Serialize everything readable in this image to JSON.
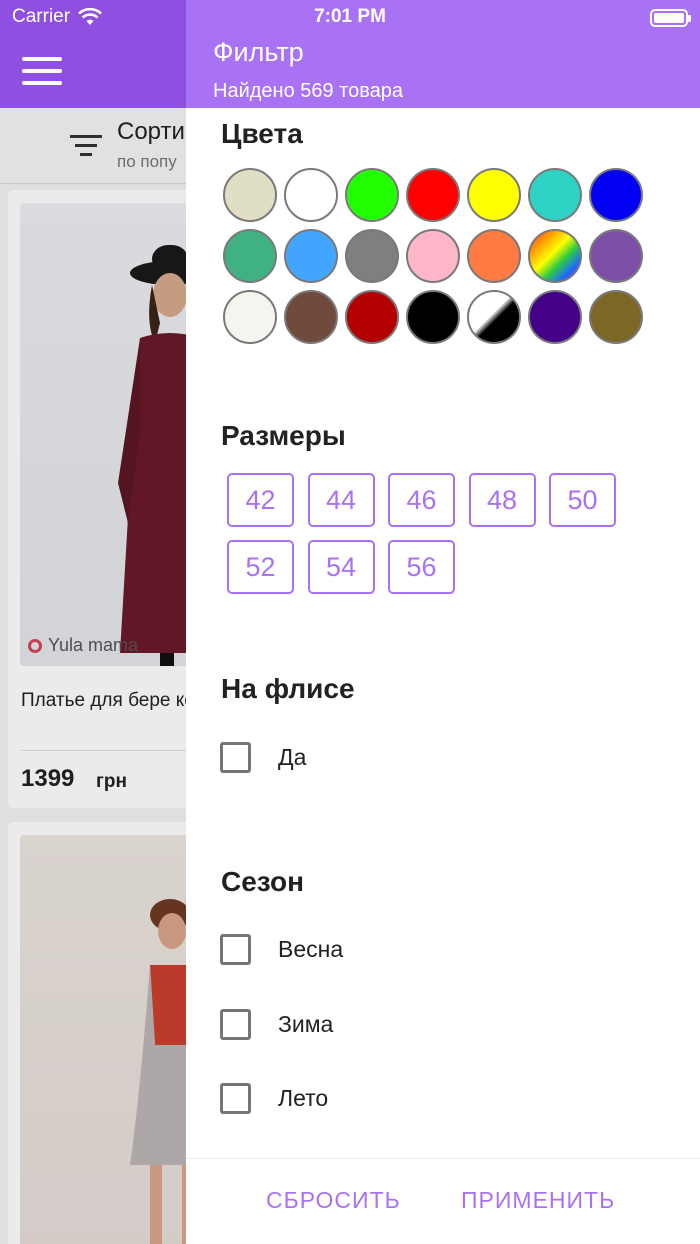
{
  "status_bar": {
    "carrier": "Carrier",
    "time": "7:01 PM"
  },
  "product_list": {
    "sort": {
      "title": "Сорти",
      "subtitle": "по попу"
    },
    "cards": [
      {
        "brand": "Yula mama",
        "title": "Платье для бере кормящих Phyllis",
        "price": "1399",
        "currency": "грн"
      },
      {
        "brand": "",
        "title": "",
        "price": "",
        "currency": ""
      }
    ]
  },
  "filter": {
    "title": "Фильтр",
    "found": "Найдено 569 товара",
    "colors_title": "Цвета",
    "colors": [
      "#e0dfc5",
      "#ffffff",
      "#22ff00",
      "#ff0000",
      "#ffff00",
      "#2ed3c6",
      "#0400f5",
      "#3fb183",
      "#42a5ff",
      "#7f7f7f",
      "#ffb6c8",
      "#ff7b41",
      "rainbow",
      "#7b4ea8",
      "#f4f5ef",
      "#6f4a3d",
      "#b30000",
      "#000000",
      "black-white",
      "#450088",
      "#7d6726"
    ],
    "sizes_title": "Размеры",
    "sizes": [
      "42",
      "44",
      "46",
      "48",
      "50",
      "52",
      "54",
      "56"
    ],
    "fleece_title": "На флисе",
    "fleece_options": [
      "Да"
    ],
    "season_title": "Сезон",
    "season_options": [
      "Весна",
      "Зима",
      "Лето"
    ],
    "reset_label": "СБРОСИТЬ",
    "apply_label": "ПРИМЕНИТЬ"
  },
  "theme": {
    "accent": "#a972f5",
    "header_dark": "#8f4fe0"
  }
}
